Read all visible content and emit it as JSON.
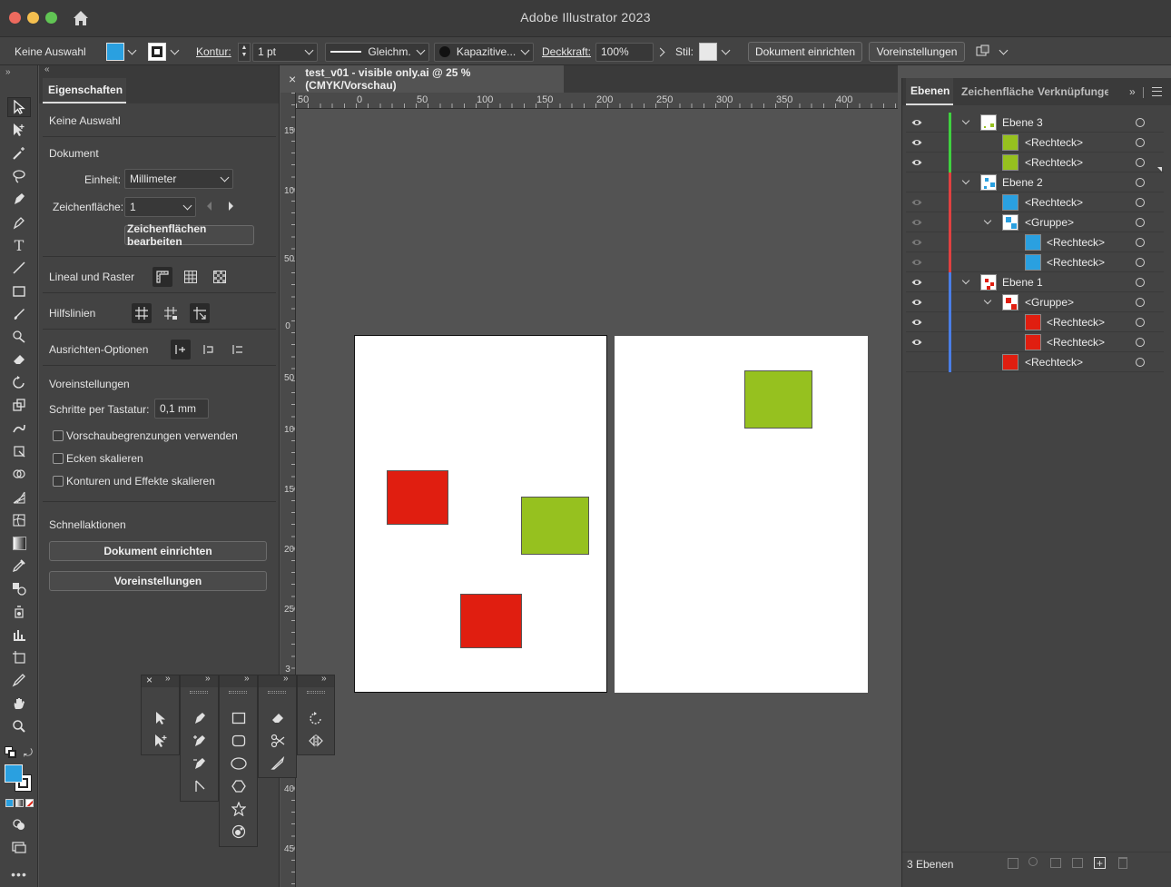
{
  "app": {
    "title": "Adobe Illustrator 2023"
  },
  "control_bar": {
    "selection": "Keine Auswahl",
    "kontur_label": "Kontur:",
    "stroke_weight": "1 pt",
    "stroke_style": "Gleichm.",
    "brush": "Kapazitive...",
    "opacity_label": "Deckkraft:",
    "opacity_value": "100%",
    "style_label": "Stil:",
    "doc_setup_button": "Dokument einrichten",
    "preferences_button": "Voreinstellungen",
    "fill_color": "#2aa0e0"
  },
  "document": {
    "tab_title": "test_v01 - visible only.ai @ 25 % (CMYK/Vorschau)",
    "close_glyph": "×",
    "ruler_h": [
      "50",
      "0",
      "50",
      "100",
      "150",
      "200",
      "250",
      "300",
      "350",
      "400"
    ],
    "ruler_v": [
      "150",
      "100",
      "50",
      "0",
      "50",
      "100",
      "150",
      "200",
      "250",
      "3",
      "400",
      "450"
    ]
  },
  "properties": {
    "tab": "Eigenschaften",
    "no_selection": "Keine Auswahl",
    "document_header": "Dokument",
    "unit_label": "Einheit:",
    "unit_value": "Millimeter",
    "artboard_label": "Zeichenfläche:",
    "artboard_value": "1",
    "edit_artboards": "Zeichenflächen bearbeiten",
    "rulers_grids": "Lineal und Raster",
    "guides": "Hilfslinien",
    "snap_options": "Ausrichten-Optionen",
    "preferences_header": "Voreinstellungen",
    "keyboard_increment_label": "Schritte per Tastatur:",
    "keyboard_increment_value": "0,1 mm",
    "checkbox_preview_bounds": "Vorschaubegrenzungen verwenden",
    "checkbox_scale_corners": "Ecken skalieren",
    "checkbox_scale_strokes": "Konturen und Effekte skalieren",
    "quick_actions": "Schnellaktionen",
    "doc_setup_button": "Dokument einrichten",
    "preferences_button": "Voreinstellungen"
  },
  "layers_panel": {
    "tabs": [
      "Ebenen",
      "Zeichenfläche",
      "Verknüpfunge"
    ],
    "footer_count": "3 Ebenen",
    "rows": [
      {
        "name": "Ebene 3",
        "color": "#3fd13f"
      },
      {
        "name": "<Rechteck>",
        "color": "#3fd13f",
        "swatch": "#96c11f"
      },
      {
        "name": "<Rechteck>",
        "color": "#3fd13f",
        "swatch": "#96c11f"
      },
      {
        "name": "Ebene 2",
        "color": "#e04040"
      },
      {
        "name": "<Rechteck>",
        "color": "#e04040",
        "swatch": "#2aa0e0"
      },
      {
        "name": "<Gruppe>",
        "color": "#e04040"
      },
      {
        "name": "<Rechteck>",
        "color": "#e04040",
        "swatch": "#2aa0e0"
      },
      {
        "name": "<Rechteck>",
        "color": "#e04040",
        "swatch": "#2aa0e0"
      },
      {
        "name": "Ebene 1",
        "color": "#4a7ee6"
      },
      {
        "name": "<Gruppe>",
        "color": "#4a7ee6"
      },
      {
        "name": "<Rechteck>",
        "color": "#4a7ee6",
        "swatch": "#e01e10"
      },
      {
        "name": "<Rechteck>",
        "color": "#4a7ee6",
        "swatch": "#e01e10"
      },
      {
        "name": "<Rechteck>",
        "color": "#4a7ee6",
        "swatch": "#e01e10"
      }
    ]
  },
  "colors": {
    "red": "#e01e10",
    "green": "#96c11f",
    "blue": "#2aa0e0"
  }
}
